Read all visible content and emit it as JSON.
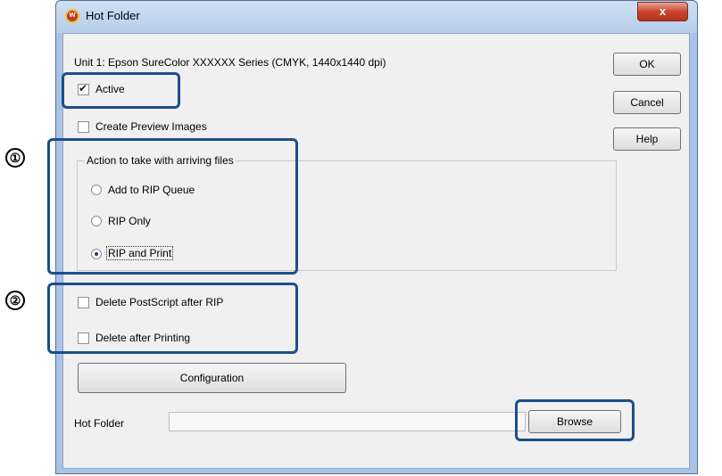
{
  "window": {
    "title": "Hot Folder",
    "close_glyph": "x",
    "app_icon_glyph": "w"
  },
  "header": {
    "unit_info": "Unit 1: Epson  SureColor XXXXXX Series (CMYK, 1440x1440 dpi)"
  },
  "buttons": {
    "ok": "OK",
    "cancel": "Cancel",
    "help": "Help",
    "configuration": "Configuration",
    "browse": "Browse"
  },
  "options": {
    "active": {
      "label": "Active",
      "checked": true
    },
    "create_preview": {
      "label": "Create Preview Images",
      "checked": false
    },
    "delete_postscript": {
      "label": "Delete PostScript after RIP",
      "checked": false
    },
    "delete_after_printing": {
      "label": "Delete after Printing",
      "checked": false
    }
  },
  "action_group": {
    "legend": "Action to take with arriving files",
    "choices": [
      {
        "label": "Add to RIP Queue",
        "selected": false
      },
      {
        "label": "RIP Only",
        "selected": false
      },
      {
        "label": "RIP and Print",
        "selected": true
      }
    ]
  },
  "hot_folder": {
    "label": "Hot Folder",
    "value": ""
  },
  "callouts": {
    "marker1": "①",
    "marker2": "②"
  },
  "colors": {
    "highlight": "#1c4f8c",
    "title_bar": "#b6cde9",
    "dialog_bg": "#f0f0f0"
  }
}
